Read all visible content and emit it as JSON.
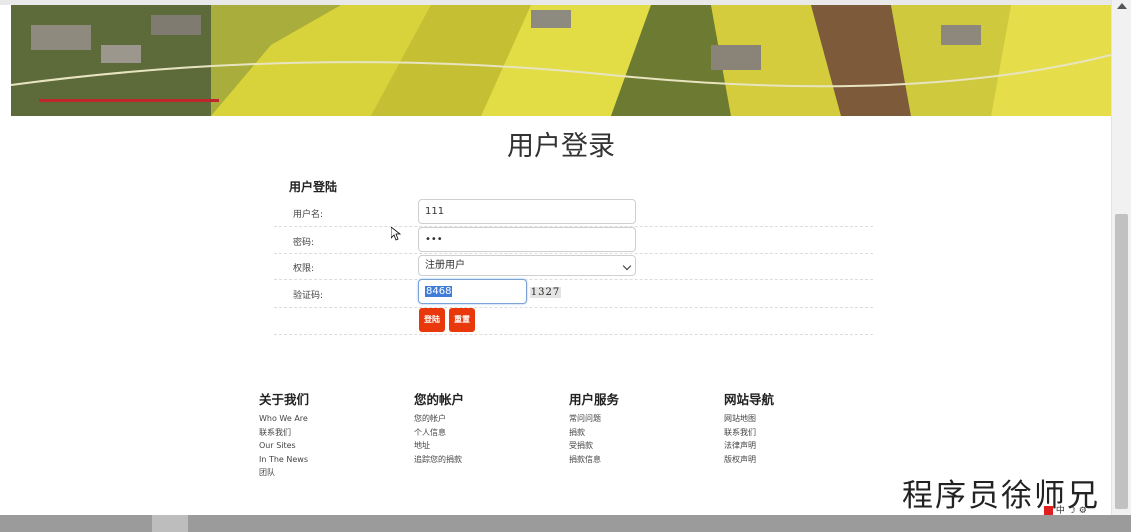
{
  "page": {
    "title": "用户登录"
  },
  "login": {
    "heading": "用户登陆",
    "username_label": "用户名:",
    "username_value": "111",
    "password_label": "密码:",
    "password_value": "•••",
    "role_label": "权限:",
    "role_selected": "注册用户",
    "captcha_label": "验证码:",
    "captcha_value": "8468",
    "captcha_image_text": "1327",
    "login_button": "登陆",
    "reset_button": "重置"
  },
  "footer": {
    "columns": [
      {
        "title": "关于我们",
        "items": [
          "Who We Are",
          "联系我们",
          "Our Sites",
          "In The News",
          "团队"
        ]
      },
      {
        "title": "您的帐户",
        "items": [
          "您的帐户",
          "个人信息",
          "地址",
          "追踪您的捐款"
        ]
      },
      {
        "title": "用户服务",
        "items": [
          "常问问题",
          "捐款",
          "受捐款",
          "捐款信息"
        ]
      },
      {
        "title": "网站导航",
        "items": [
          "网站地图",
          "联系我们",
          "法律声明",
          "版权声明"
        ]
      }
    ]
  },
  "watermark": "程序员徐师兄",
  "tray": {
    "ime_text": "中",
    "icons": [
      "app-icon",
      "ime-icon",
      "moon-icon",
      "settings-icon"
    ]
  },
  "colors": {
    "button": "#e8380c",
    "banner_line": "#c0272d",
    "selection": "#3f7dd8"
  }
}
